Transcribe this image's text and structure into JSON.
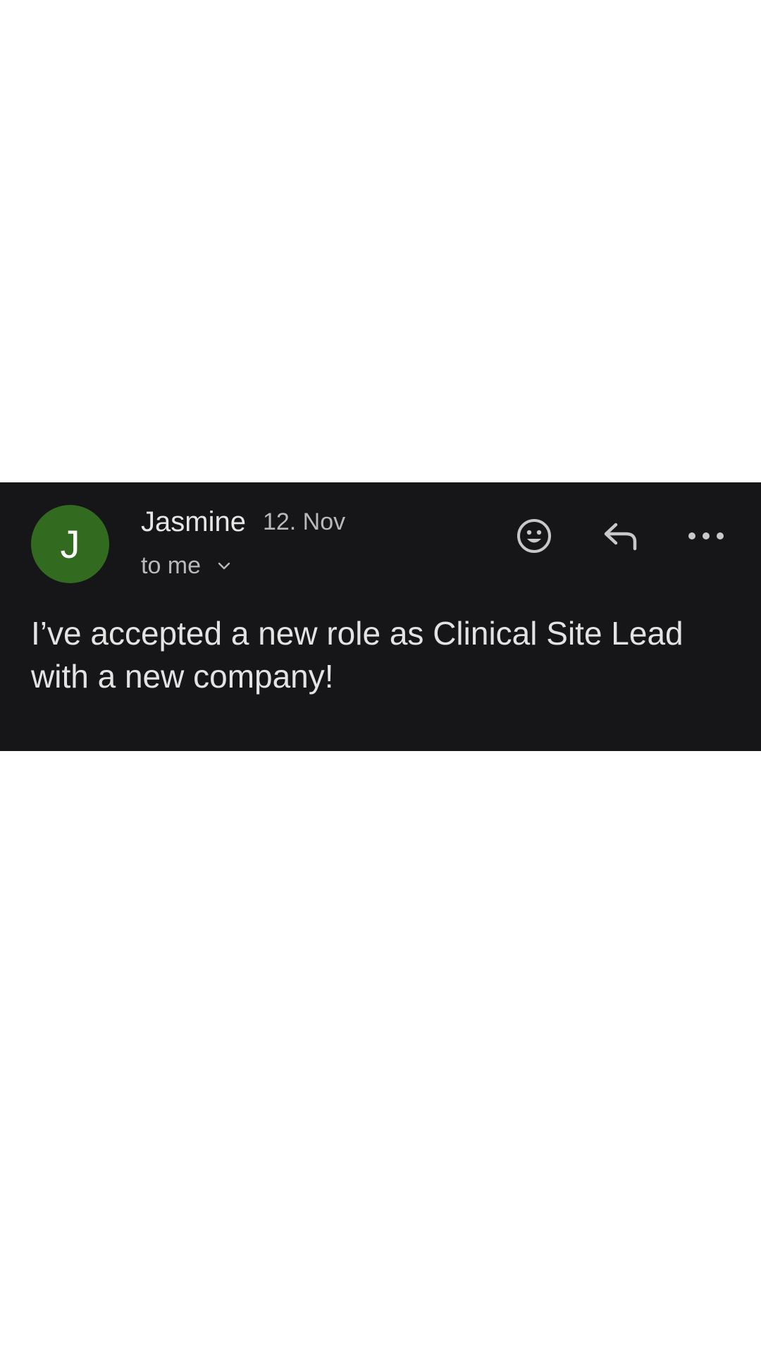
{
  "email": {
    "avatar_initial": "J",
    "avatar_color": "#326b1f",
    "sender_name": "Jasmine",
    "date": "12. Nov",
    "recipient_label": "to me",
    "body": "I’ve accepted a new role as Clinical Site Lead with a new company!"
  },
  "icons": {
    "recipient_toggle": "chevron-down-icon",
    "emoji": "emoji-reaction-icon",
    "reply": "reply-icon",
    "more": "more-options-icon"
  },
  "colors": {
    "card_background": "#161618",
    "text_primary": "#e3e3e3",
    "text_secondary": "#b9b9b9"
  }
}
